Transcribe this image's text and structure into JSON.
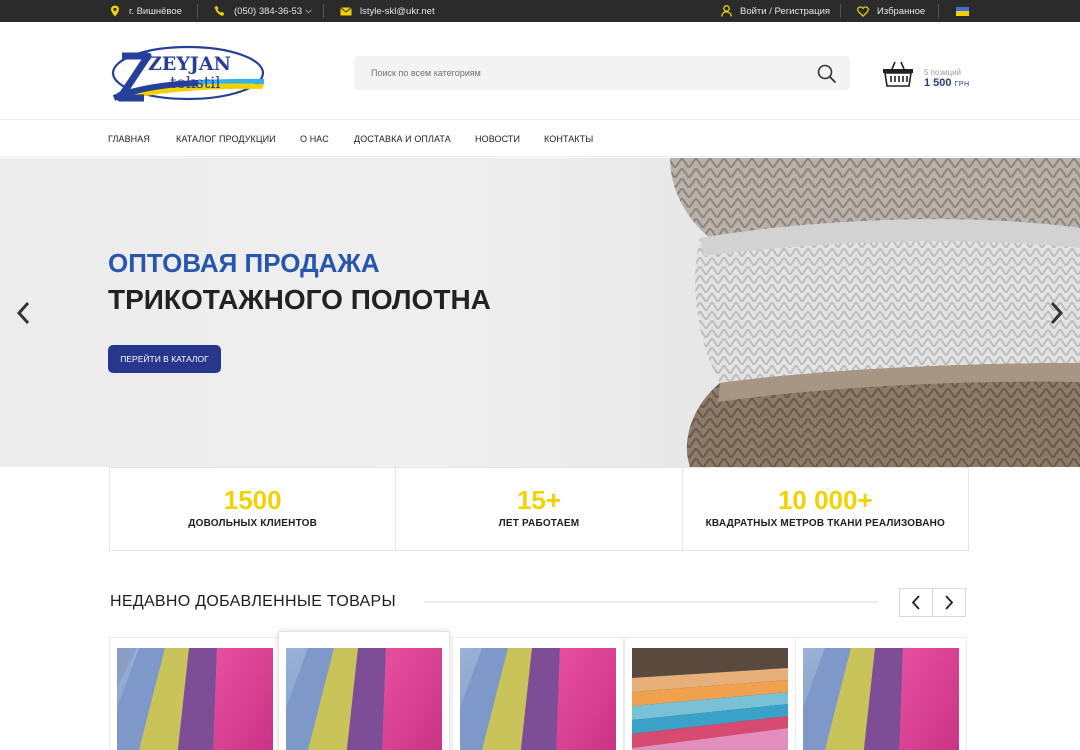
{
  "topbar": {
    "location": "г. Вишнёвое",
    "phone": "(050) 384-36-53",
    "email": "lstyle-skl@ukr.net",
    "login": "Войти / Регистрация",
    "favorites": "Избранное"
  },
  "logo": {
    "line1": "ZEYJAN",
    "line2": "tekstil"
  },
  "search": {
    "placeholder": "Поиск по всем категориям"
  },
  "cart": {
    "count": "5 позиций",
    "total": "1 500",
    "currency": "грн"
  },
  "nav": [
    "ГЛАВНАЯ",
    "КАТАЛОГ ПРОДУКЦИИ",
    "О НАС",
    "ДОСТАВКА И ОПЛАТА",
    "НОВОСТИ",
    "КОНТАКТЫ"
  ],
  "hero": {
    "line1": "ОПТОВАЯ ПРОДАЖА",
    "line2": "ТРИКОТАЖНОГО ПОЛОТНА",
    "cta": "ПЕРЕЙТИ В КАТАЛОГ"
  },
  "stats": [
    {
      "value": "1500",
      "label": "ДОВОЛЬНЫХ КЛИЕНТОВ"
    },
    {
      "value": "15+",
      "label": "ЛЕТ РАБОТАЕМ"
    },
    {
      "value": "10 000+",
      "label": "КВАДРАТНЫХ МЕТРОВ ТКАНИ РЕАЛИЗОВАНО"
    }
  ],
  "recent": {
    "title": "НЕДАВНО ДОБАВЛЕННЫЕ ТОВАРЫ"
  },
  "colors": {
    "accent_blue": "#2656ad",
    "button_navy": "#26378d",
    "stat_yellow": "#f2d300",
    "topbar": "#2b2b2b"
  },
  "icons": [
    "location-pin-icon",
    "phone-icon",
    "mail-icon",
    "user-icon",
    "heart-icon",
    "ukraine-flag-icon",
    "search-icon",
    "basket-icon",
    "chevron-left-icon",
    "chevron-right-icon"
  ]
}
